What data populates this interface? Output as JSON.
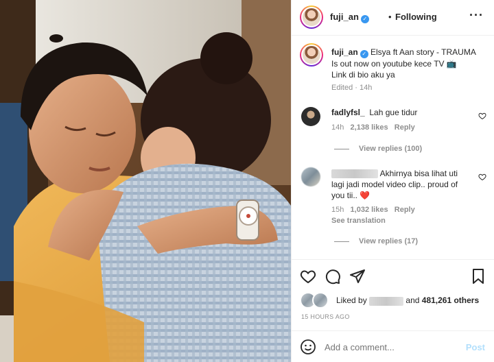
{
  "post": {
    "username": "fuji_an",
    "follow_status": "Following",
    "separator": "•",
    "more_icon": "more-horizontal-icon",
    "caption": {
      "username": "fuji_an",
      "line1": "Elsya ft Aan story - TRAUMA",
      "line2": "Is out now on youtube kece TV 📺",
      "line3": "Link di bio aku ya",
      "edited": "Edited · 14h"
    }
  },
  "comments": [
    {
      "username": "fadlyfsl_",
      "text": "Lah gue tidur",
      "time": "14h",
      "likes": "2,138 likes",
      "reply": "Reply",
      "view_replies": "View replies (100)"
    },
    {
      "username": "",
      "text_a": "Akhirnya bisa lihat uti",
      "text_b": "lagi jadi model video clip.. proud of",
      "text_c": "you tii..",
      "emoji": "❤️",
      "time": "15h",
      "likes": "1,032 likes",
      "reply": "Reply",
      "translation": "See translation",
      "view_replies": "View replies (17)"
    }
  ],
  "likes": {
    "prefix": "Liked by",
    "middle": "and",
    "count": "481,261 others"
  },
  "timestamp": "15 HOURS AGO",
  "comment_box": {
    "placeholder": "Add a comment...",
    "post_label": "Post"
  },
  "colors": {
    "verified": "#3897f0",
    "heart": "#ed4956",
    "post_disabled": "#b2dffc",
    "meta_gray": "#8e8e8e"
  }
}
